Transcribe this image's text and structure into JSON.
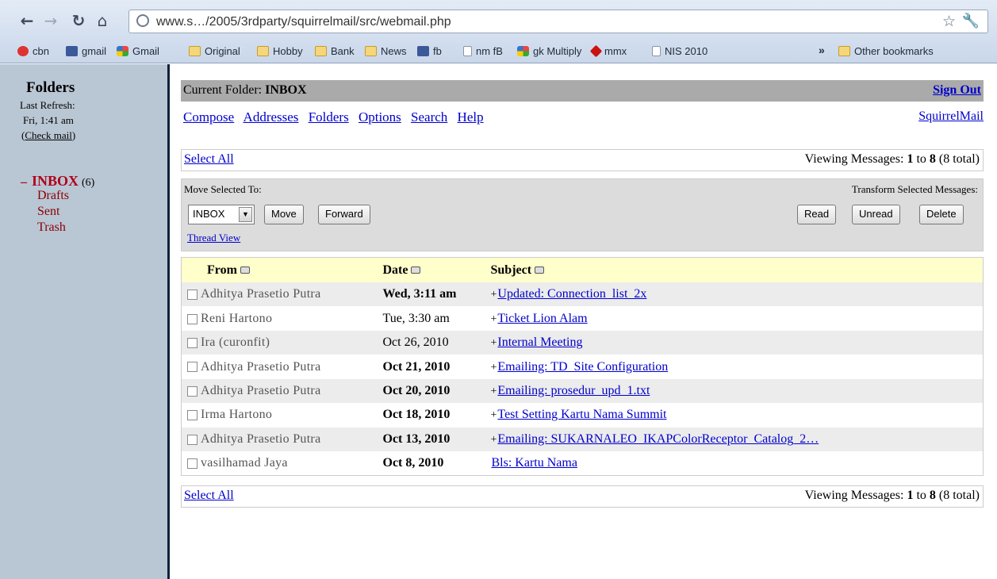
{
  "browser": {
    "url": "www.s…/2005/3rdparty/squirrelmail/src/webmail.php",
    "bookmarks": [
      {
        "label": "cbn",
        "icon": "cbn"
      },
      {
        "label": "gmail",
        "icon": "fb"
      },
      {
        "label": "Gmail",
        "icon": "gl"
      },
      {
        "label": "Original",
        "icon": "folder"
      },
      {
        "label": "Hobby",
        "icon": "folder"
      },
      {
        "label": "Bank",
        "icon": "folder"
      },
      {
        "label": "News",
        "icon": "folder"
      },
      {
        "label": "fb",
        "icon": "fb"
      },
      {
        "label": "nm fB",
        "icon": "page"
      },
      {
        "label": "gk Multiply",
        "icon": "gl"
      },
      {
        "label": "mmx",
        "icon": "mmx"
      },
      {
        "label": "NIS 2010",
        "icon": "page"
      },
      {
        "label": "Other bookmarks",
        "icon": "folder"
      }
    ],
    "more_label": "»"
  },
  "sidebar": {
    "title": "Folders",
    "last_refresh_label": "Last Refresh:",
    "last_refresh_time": "Fri, 1:41 am",
    "check_mail": "Check mail",
    "inbox": {
      "minus": "–",
      "name": "INBOX",
      "count": "(6)"
    },
    "folders": [
      "Drafts",
      "Sent",
      "Trash"
    ]
  },
  "header": {
    "current_folder_label": "Current Folder:",
    "current_folder": "INBOX",
    "sign_out": "Sign Out",
    "menu": [
      "Compose",
      "Addresses",
      "Folders",
      "Options",
      "Search",
      "Help"
    ],
    "squirrelmail": "SquirrelMail"
  },
  "list": {
    "select_all": "Select All",
    "viewing": {
      "prefix": "Viewing Messages:",
      "from": "1",
      "to_word": "to",
      "to": "8",
      "total": "(8 total)"
    },
    "move_label": "Move Selected To:",
    "move_target": "INBOX",
    "move_button": "Move",
    "forward_button": "Forward",
    "thread_view": "Thread View",
    "transform_label": "Transform Selected Messages:",
    "read_button": "Read",
    "unread_button": "Unread",
    "delete_button": "Delete",
    "columns": {
      "from": "From",
      "date": "Date",
      "subject": "Subject"
    }
  },
  "messages": [
    {
      "from": "Adhitya Prasetio Putra",
      "date": "Wed, 3:11 am",
      "subject": "Updated: Connection_list_2x",
      "plus": "+",
      "unseen": true
    },
    {
      "from": "Reni Hartono",
      "date": "Tue, 3:30 am",
      "subject": "Ticket Lion Alam",
      "plus": "+",
      "unseen": false
    },
    {
      "from": "Ira (curonfit)",
      "date": "Oct 26, 2010",
      "subject": "Internal Meeting",
      "plus": "+",
      "unseen": false
    },
    {
      "from": "Adhitya Prasetio Putra",
      "date": "Oct 21, 2010",
      "subject": "Emailing: TD_Site Configuration",
      "plus": "+",
      "unseen": true
    },
    {
      "from": "Adhitya Prasetio Putra",
      "date": "Oct 20, 2010",
      "subject": "Emailing: prosedur_upd_1.txt",
      "plus": "+",
      "unseen": true
    },
    {
      "from": "Irma Hartono",
      "date": "Oct 18, 2010",
      "subject": "Test Setting Kartu Nama Summit",
      "plus": "+",
      "unseen": true
    },
    {
      "from": "Adhitya Prasetio Putra",
      "date": "Oct 13, 2010",
      "subject": "Emailing: SUKARNALEO_IKAPColorReceptor_Catalog_2…",
      "plus": "+",
      "unseen": true
    },
    {
      "from": "vasilhamad Jaya",
      "date": "Oct 8, 2010",
      "subject": "Bls: Kartu Nama",
      "plus": "",
      "unseen": true
    }
  ]
}
